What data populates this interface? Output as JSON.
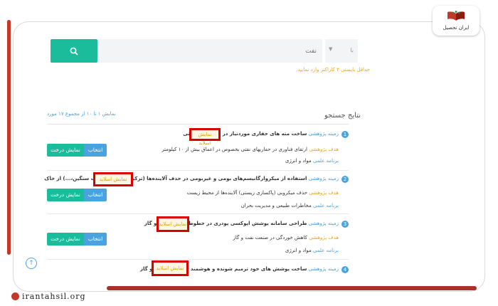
{
  "brand": {
    "logo_text": "ایران تحصیل",
    "footer_url": "irantahsil.org"
  },
  "search": {
    "placeholder": "نفت",
    "button_icon": "search-icon",
    "select_value": "با",
    "hint": "حداقل بایستی ۳ کاراکتر وارد نمایید."
  },
  "results": {
    "title": "نتایج جستجو",
    "count_text": "نمایش ۱ تا ۱۰ از مجموع ۱۷ مورد",
    "more_label": "نمایش اسلاید",
    "tree_label": "نمایش درخت",
    "select_label": "انتخاب",
    "items": [
      {
        "num": "1",
        "field_label": "زمینه پژوهشی",
        "field_value": "ساخت مته های حفاری موردنیاز در حفاریهای نفتی",
        "goal_label": "هدف پژوهشی",
        "goal_value": "ارتقای فناوری در حفاریهای نفتی بخصوص در اعماق بیش از ۱۰ کیلومتر",
        "program_label": "برنامه علمی",
        "program_value": "مواد و انرژی"
      },
      {
        "num": "2",
        "field_label": "زمینه پژوهشی",
        "field_value": "استفاده از میکروارگانیسم‌های بومی و غیربومی در حذف آلاینده‌ها (ترکیبات نفتی، فلزات سنگین،...) از خاک",
        "goal_label": "هدف پژوهشی",
        "goal_value": "حذف میکروبی (پاکسازی زیستی) آلاینده‌ها از محیط زیست",
        "program_label": "برنامه علمی",
        "program_value": "مخاطرات طبیعی و مدیریت بحران"
      },
      {
        "num": "3",
        "field_label": "زمینه پژوهشی",
        "field_value": "طراحی سامانه پوشش اپوکسی پودری در خطوط انتقال نفت و گاز",
        "goal_label": "هدف پژوهشی",
        "goal_value": "کاهش خوردگی در صنعت نفت و گاز",
        "program_label": "برنامه علمی",
        "program_value": "مواد و انرژی"
      },
      {
        "num": "4",
        "field_label": "زمینه پژوهشی",
        "field_value": "ساخت پوشش های خود ترمیم شونده و هوشمند در صنعت نفت و گاز"
      }
    ]
  }
}
